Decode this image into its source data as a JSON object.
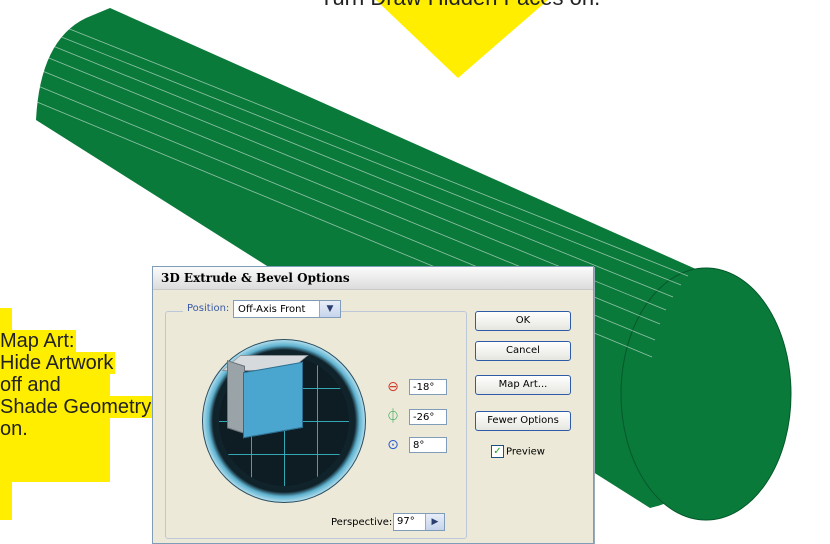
{
  "callouts": {
    "top": "Turn Draw Hidden Faces on.",
    "left_lines": [
      "Map Art:",
      "Hide Artwork",
      "off and",
      "Shade Geometry",
      "on."
    ]
  },
  "colors": {
    "tube": "#0a7a3a",
    "tube_light": "#0f8a43",
    "highlight": "#ffee00"
  },
  "dialog": {
    "title": "3D Extrude & Bevel Options",
    "position_label": "Position:",
    "position_value": "Off-Axis Front",
    "rotation_x": "-18°",
    "rotation_y": "-26°",
    "rotation_z": "8°",
    "perspective_label": "Perspective:",
    "perspective_value": "97°",
    "buttons": {
      "ok": "OK",
      "cancel": "Cancel",
      "map_art": "Map Art...",
      "fewer_options": "Fewer Options"
    },
    "preview_label": "Preview",
    "preview_checked": true
  },
  "icons": {
    "position_dropdown": "chevron-down-icon",
    "perspective_arrow": "arrow-right-icon",
    "x_axis": "x-rotation-icon",
    "y_axis": "y-rotation-icon",
    "z_axis": "z-rotation-icon"
  }
}
